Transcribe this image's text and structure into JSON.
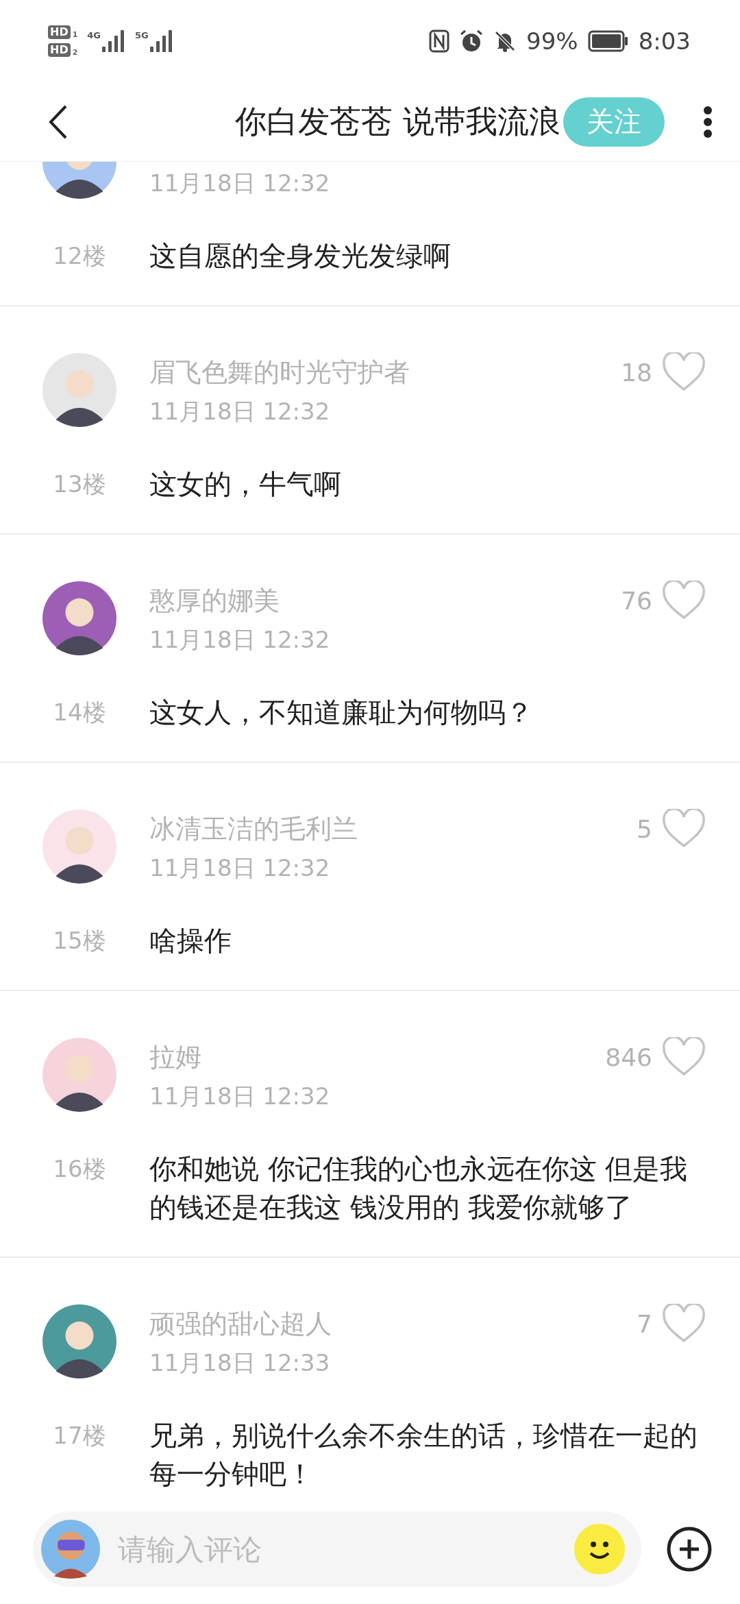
{
  "status_bar": {
    "sims": [
      {
        "label": "HD",
        "slot": "1"
      },
      {
        "label": "HD",
        "slot": "2"
      }
    ],
    "networks": [
      "4G",
      "5G"
    ],
    "battery": "99%",
    "time": "8:03"
  },
  "header": {
    "title": "你白发苍苍 说带我流浪",
    "follow": "关注"
  },
  "comments": [
    {
      "floor": "12楼",
      "date": "11月18日 12:32",
      "text": "这自愿的全身发光发绿啊",
      "color": "#a9c6f2"
    },
    {
      "floor": "13楼",
      "name": "眉飞色舞的时光守护者",
      "likes": "18",
      "date": "11月18日 12:32",
      "text": "这女的，牛气啊",
      "color": "#e6e6e6"
    },
    {
      "floor": "14楼",
      "name": "憨厚的娜美",
      "likes": "76",
      "date": "11月18日 12:32",
      "text": "这女人，不知道廉耻为何物吗？",
      "color": "#9c5fb5"
    },
    {
      "floor": "15楼",
      "name": "冰清玉洁的毛利兰",
      "likes": "5",
      "date": "11月18日 12:32",
      "text": "啥操作",
      "color": "#fbe3ea"
    },
    {
      "floor": "16楼",
      "name": "拉姆",
      "likes": "846",
      "date": "11月18日 12:32",
      "text": "你和她说 你记住我的心也永远在你这 但是我的钱还是在我这 钱没用的 我爱你就够了",
      "color": "#f7d3dc"
    },
    {
      "floor": "17楼",
      "name": "顽强的甜心超人",
      "likes": "7",
      "date": "11月18日 12:33",
      "text": "兄弟，别说什么余不余生的话，珍惜在一起的每一分钟吧！",
      "color": "#4d9a9c"
    }
  ],
  "composer": {
    "placeholder": "请输入评论"
  }
}
